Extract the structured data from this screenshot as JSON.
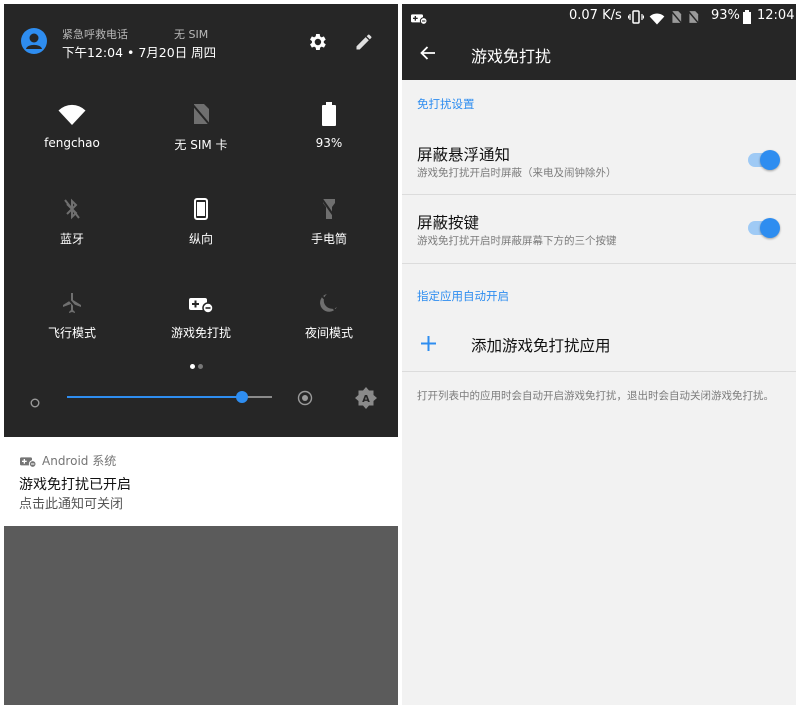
{
  "left": {
    "header": {
      "emergency": "紧急呼救电话",
      "sim": "无 SIM",
      "datetime": "下午12:04 • 7月20日 周四"
    },
    "tiles": [
      {
        "label": "fengchao",
        "icon": "wifi-icon",
        "active": true
      },
      {
        "label": "无 SIM 卡",
        "icon": "no-sim-icon",
        "active": false
      },
      {
        "label": "93%",
        "icon": "battery-icon",
        "active": true
      },
      {
        "label": "蓝牙",
        "icon": "bluetooth-off-icon",
        "active": false
      },
      {
        "label": "纵向",
        "icon": "portrait-icon",
        "active": true
      },
      {
        "label": "手电筒",
        "icon": "flashlight-off-icon",
        "active": false
      },
      {
        "label": "飞行模式",
        "icon": "airplane-off-icon",
        "active": false
      },
      {
        "label": "游戏免打扰",
        "icon": "game-dnd-icon",
        "active": true
      },
      {
        "label": "夜间模式",
        "icon": "night-mode-off-icon",
        "active": false
      }
    ],
    "brightness": 0.85,
    "notification": {
      "app": "Android 系统",
      "title": "游戏免打扰已开启",
      "text": "点击此通知可关闭"
    }
  },
  "right": {
    "status": {
      "speed": "0.07 K/s",
      "battery": "93%",
      "time": "12:04"
    },
    "title": "游戏免打扰",
    "section1": "免打扰设置",
    "rows": [
      {
        "title": "屏蔽悬浮通知",
        "subtitle": "游戏免打扰开启时屏蔽（来电及闹钟除外）",
        "on": true
      },
      {
        "title": "屏蔽按键",
        "subtitle": "游戏免打扰开启时屏蔽屏幕下方的三个按键",
        "on": true
      }
    ],
    "section2": "指定应用自动开启",
    "add_label": "添加游戏免打扰应用",
    "footer": "打开列表中的应用时会自动开启游戏免打扰，退出时会自动关闭游戏免打扰。"
  },
  "colors": {
    "accent": "#2e8df0",
    "panel_dark": "#262626",
    "scrim": "#5b5b5b"
  }
}
